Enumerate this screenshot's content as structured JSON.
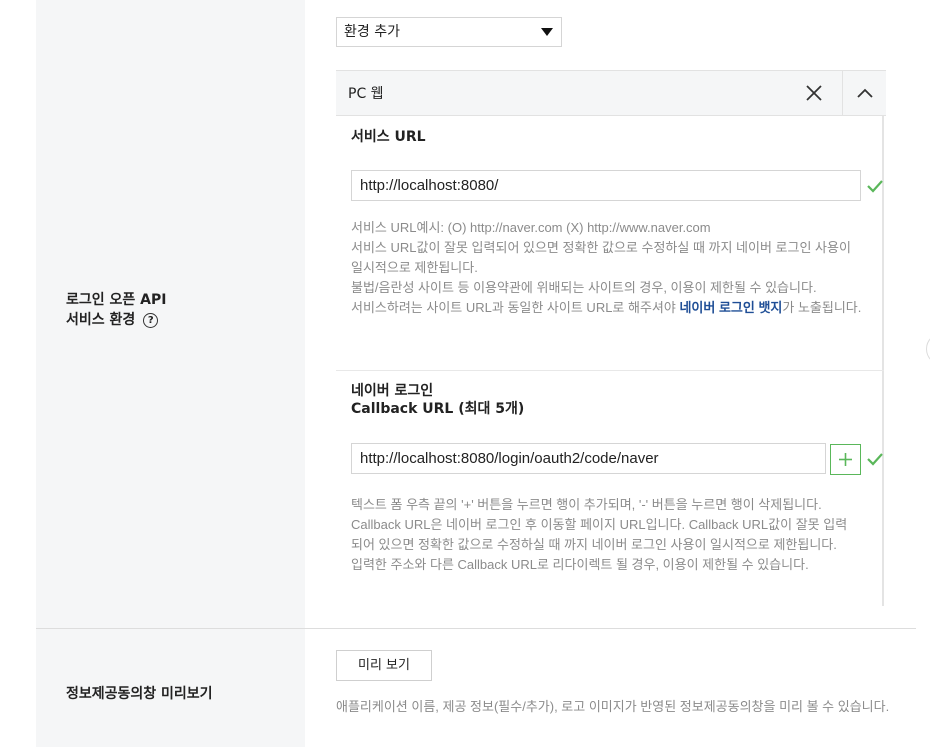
{
  "sections": {
    "login_api_env": {
      "label_line1": "로그인 오픈 API",
      "label_line2": "서비스 환경",
      "help_icon": "?"
    },
    "consent_preview": {
      "label": "정보제공동의창 미리보기",
      "button_label": "미리 보기",
      "help_text": "애플리케이션 이름, 제공 정보(필수/추가), 로고 이미지가 반영된 정보제공동의창을 미리 볼 수 있습니다."
    }
  },
  "env_select": {
    "selected": "환경 추가",
    "icon": "caret-down-icon"
  },
  "panel": {
    "title": "PC 웹",
    "close_icon": "close-icon",
    "toggle_icon": "chevron-up-icon"
  },
  "service_url": {
    "title": "서비스 URL",
    "value": "http://localhost:8080/",
    "status_icon": "check-icon",
    "help_lines": [
      "서비스 URL예시: (O) http://naver.com (X) http://www.naver.com",
      "서비스 URL값이 잘못 입력되어 있으면 정확한 값으로 수정하실 때 까지 네이버 로그인 사용이 일시적으로 제한됩니다.",
      "불법/음란성 사이트 등 이용약관에 위배되는 사이트의 경우, 이용이 제한될 수 있습니다."
    ],
    "help_last_prefix": "서비스하려는 사이트 URL과 동일한 사이트 URL로 해주셔야 ",
    "help_last_link": "네이버 로그인 뱃지",
    "help_last_suffix": "가 노출됩니다."
  },
  "callback_url": {
    "title_line1": "네이버 로그인",
    "title_line2": "Callback URL (최대 5개)",
    "value": "http://localhost:8080/login/oauth2/code/naver",
    "add_button_icon": "plus-icon",
    "status_icon": "check-icon",
    "help_lines": [
      "텍스트 폼 우측 끝의 '+' 버튼을 누르면 행이 추가되며, '-' 버튼을 누르면 행이 삭제됩니다.",
      "Callback URL은 네이버 로그인 후 이동할 페이지 URL입니다. Callback URL값이 잘못 입력되어 있으면 정확한 값으로 수정하실 때 까지 네이버 로그인 사용이 일시적으로 제한됩니다.",
      "입력한 주소와 다른 Callback URL로 리다이렉트 될 경우, 이용이 제한될 수 있습니다."
    ]
  },
  "colors": {
    "accent_green": "#5ab75a",
    "link_blue": "#1f4e96",
    "label_bg": "#f5f6f7"
  }
}
